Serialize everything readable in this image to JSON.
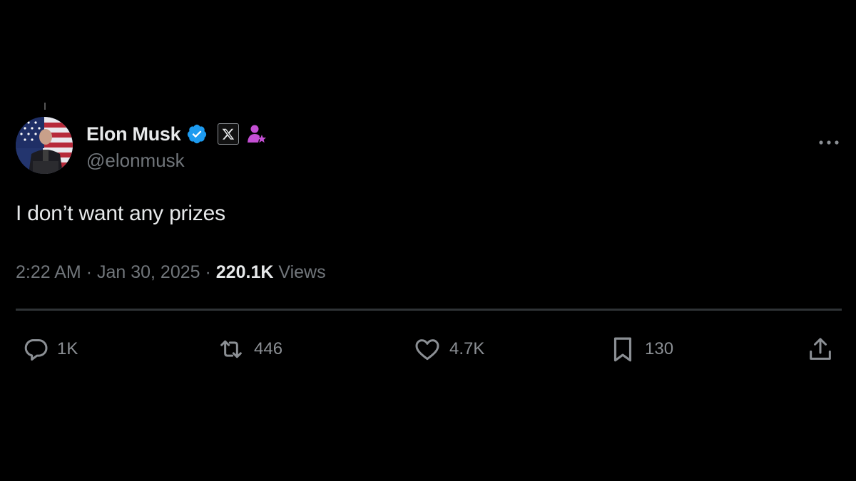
{
  "post": {
    "author": {
      "display_name": "Elon Musk",
      "handle": "@elonmusk",
      "verified_color": "#1d9bf0",
      "affiliate_badge": "x-logo-badge",
      "gov_badge_color": "#c44fd4"
    },
    "text": "I don’t want any prizes",
    "meta": {
      "time": "2:22 AM",
      "separator": "·",
      "date": "Jan 30, 2025",
      "views_count": "220.1K",
      "views_label": "Views"
    },
    "actions": {
      "replies": "1K",
      "reposts": "446",
      "likes": "4.7K",
      "bookmarks": "130"
    }
  },
  "icons": {
    "more": "more-options-icon",
    "reply": "reply-icon",
    "repost": "repost-icon",
    "like": "heart-icon",
    "bookmark": "bookmark-icon",
    "share": "share-icon"
  },
  "colors": {
    "background": "#000000",
    "text_primary": "#e7e9ea",
    "text_secondary": "#71767b",
    "divider": "#2f3336"
  }
}
